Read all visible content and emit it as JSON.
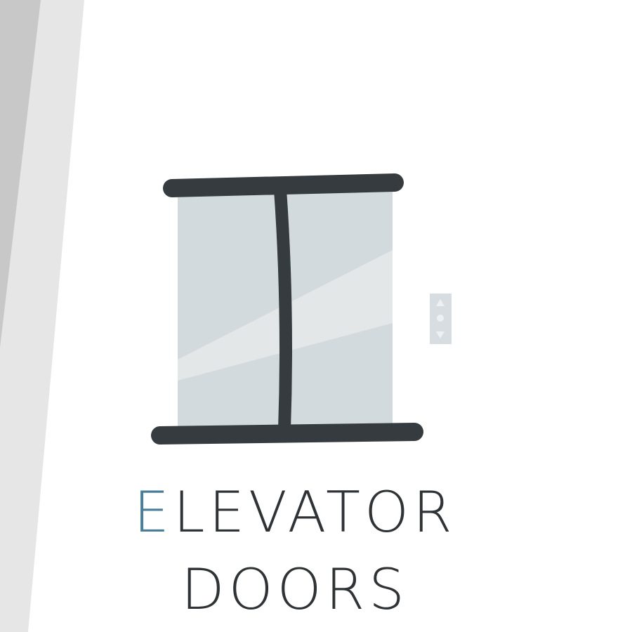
{
  "title": {
    "line1_initial": "E",
    "line1_rest": "LEVATOR",
    "line2": "DOORS"
  },
  "colors": {
    "background": "#ffffff",
    "stripe_dark": "#c8c8c8",
    "stripe_light": "#e6e6e6",
    "frame": "#363b3f",
    "door_glass": "#d3dadd",
    "door_glare": "#e3e7e8",
    "call_panel": "#d7dde1",
    "text": "#2f3336",
    "accent": "#4a7d98"
  },
  "icons": {
    "elevator": "elevator-doors-icon",
    "call_button": "up-down-call-button-icon"
  }
}
